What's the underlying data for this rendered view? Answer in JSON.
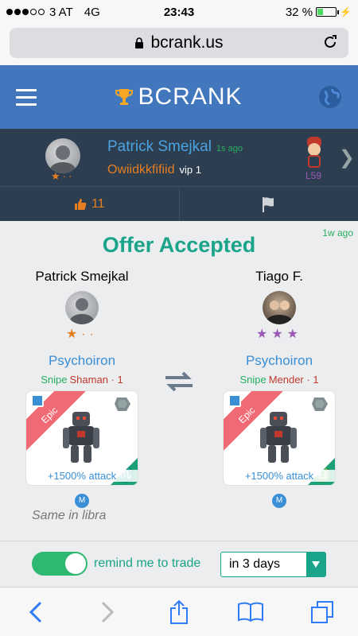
{
  "status_bar": {
    "carrier": "3 AT",
    "network": "4G",
    "time": "23:43",
    "battery": "32 %",
    "battery_level": 0.32
  },
  "browser": {
    "url": "bcrank.us"
  },
  "app": {
    "brand": "BCRANK"
  },
  "user_strip": {
    "name": "Patrick Smejkal",
    "time_ago": "1s ago",
    "game_name": "Owiidkkfifiid",
    "vip": "vip 1",
    "level": "L59",
    "rank_stars": "★··",
    "likes": "11"
  },
  "offer": {
    "title": "Offer Accepted",
    "time_ago": "1w ago",
    "left": {
      "player": "Patrick Smejkal",
      "stars": "★··",
      "monster": "Psychoiron",
      "snipe": "Snipe",
      "class": "Shaman · 1",
      "rarity": "Epic",
      "bonus": "+1500% attack",
      "sign": "♏",
      "badge": "M"
    },
    "right": {
      "player": "Tiago F.",
      "stars": "★★★",
      "monster": "Psychoiron",
      "snipe": "Snipe",
      "class": "Mender · 1",
      "rarity": "Epic",
      "bonus": "+1500% attack",
      "sign": "♎",
      "badge": "M"
    },
    "note": "Same in libra"
  },
  "remind": {
    "label": "remind me to trade",
    "enabled": true,
    "selected": "in 3 days"
  },
  "colors": {
    "header_blue": "#4276bd",
    "strip_dark": "#2c3e50",
    "teal": "#1aa48a",
    "orange": "#e67e22",
    "purple": "#9b59b6",
    "link_blue": "#3a8fd6"
  }
}
